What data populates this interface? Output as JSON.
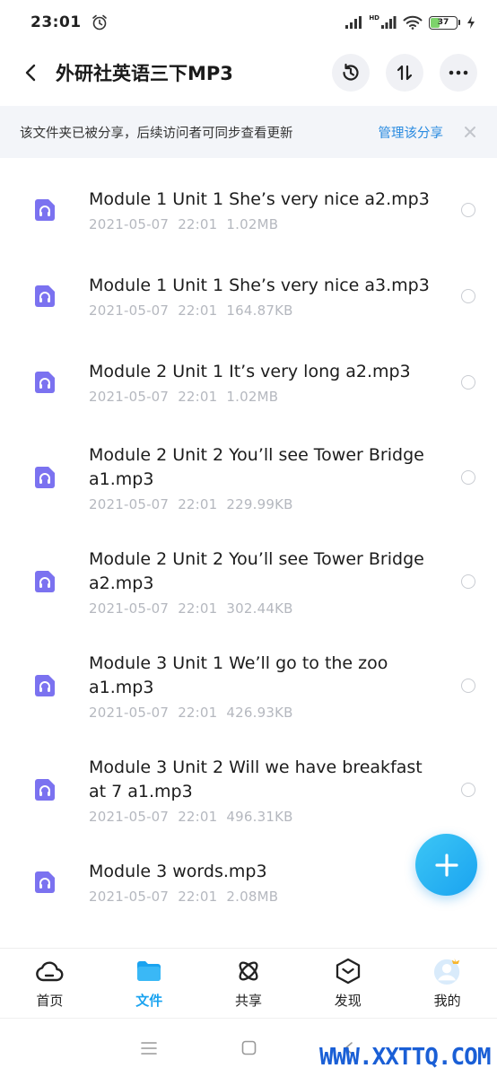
{
  "status": {
    "time": "23:01",
    "battery": "37",
    "battery_level": 0.37,
    "network": "HD"
  },
  "header": {
    "title": "外研社英语三下MP3"
  },
  "banner": {
    "text": "该文件夹已被分享，后续访问者可同步查看更新",
    "link": "管理该分享"
  },
  "files": [
    {
      "name": "Module 1 Unit 1 She’s very nice a2.mp3",
      "date": "2021-05-07",
      "time": "22:01",
      "size": "1.02MB"
    },
    {
      "name": "Module 1 Unit 1 She’s very nice a3.mp3",
      "date": "2021-05-07",
      "time": "22:01",
      "size": "164.87KB"
    },
    {
      "name": "Module 2 Unit 1 It’s very long a2.mp3",
      "date": "2021-05-07",
      "time": "22:01",
      "size": "1.02MB"
    },
    {
      "name": "Module 2 Unit 2 You’ll see Tower Bridge a1.mp3",
      "date": "2021-05-07",
      "time": "22:01",
      "size": "229.99KB"
    },
    {
      "name": "Module 2 Unit 2 You’ll see Tower Bridge a2.mp3",
      "date": "2021-05-07",
      "time": "22:01",
      "size": "302.44KB"
    },
    {
      "name": "Module 3 Unit 1 We’ll go to the zoo a1.mp3",
      "date": "2021-05-07",
      "time": "22:01",
      "size": "426.93KB"
    },
    {
      "name": "Module 3 Unit 2 Will we have breakfast at 7 a1.mp3",
      "date": "2021-05-07",
      "time": "22:01",
      "size": "496.31KB"
    },
    {
      "name": "Module 3 words.mp3",
      "date": "2021-05-07",
      "time": "22:01",
      "size": "2.08MB"
    }
  ],
  "nav": {
    "home": "首页",
    "files": "文件",
    "share": "共享",
    "discover": "发现",
    "mine": "我的"
  },
  "watermark": "WWW.XXTTQ.COM",
  "colors": {
    "accent": "#1aa3f0",
    "file_icon": "#7b72f0",
    "link": "#2a8be0"
  }
}
